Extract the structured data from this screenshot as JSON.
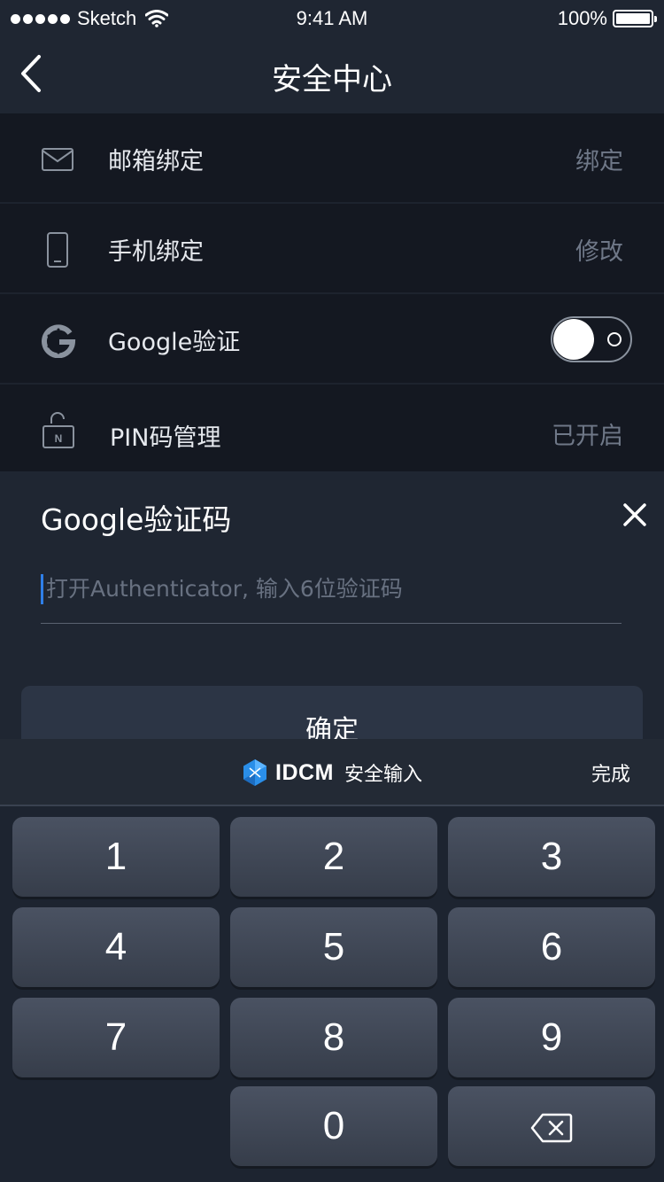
{
  "status_bar": {
    "carrier": "Sketch",
    "time": "9:41 AM",
    "battery": "100%"
  },
  "nav": {
    "title": "安全中心",
    "back_icon": "chevron-left-icon"
  },
  "list": [
    {
      "icon": "mail-icon",
      "label": "邮箱绑定",
      "action": "绑定"
    },
    {
      "icon": "phone-icon",
      "label": "手机绑定",
      "action": "修改"
    },
    {
      "icon": "google-icon",
      "label": "Google验证",
      "toggle": true
    },
    {
      "icon": "pin-lock-icon",
      "label": "PIN码管理",
      "action": "已开启",
      "icon_text": "N"
    }
  ],
  "modal": {
    "title": "Google验证码",
    "close_icon": "close-icon",
    "input_value": "",
    "input_placeholder": "打开Authenticator, 输入6位验证码",
    "confirm_label": "确定"
  },
  "keyboard": {
    "brand": "IDCM",
    "subtitle": "安全输入",
    "done_label": "完成",
    "keys": [
      "1",
      "2",
      "3",
      "4",
      "5",
      "6",
      "7",
      "8",
      "9",
      "0"
    ],
    "delete_icon": "backspace-icon"
  },
  "colors": {
    "background": "#141821",
    "surface": "#1f2632",
    "accent_caret": "#2f7fe8",
    "muted_text": "#6f7888",
    "logo_blue": "#2a8ee8"
  }
}
